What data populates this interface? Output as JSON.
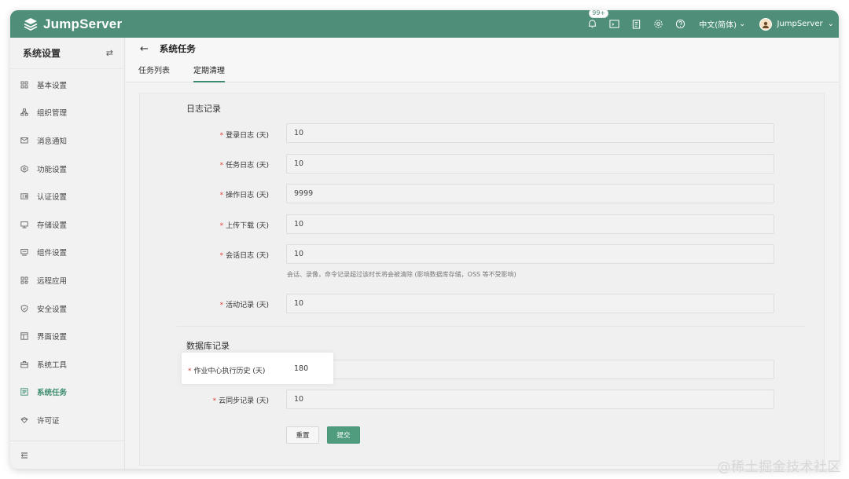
{
  "app": {
    "brand": "JumpServer",
    "accent": "#4f8e79"
  },
  "header": {
    "notification_badge": "99+",
    "icons": [
      "bell-icon",
      "terminal-icon",
      "clipboard-icon",
      "gear-icon",
      "help-icon"
    ],
    "language": "中文(简体)",
    "username": "JumpServer"
  },
  "sidebar": {
    "title": "系统设置",
    "items": [
      {
        "label": "基本设置",
        "icon": "grid-icon"
      },
      {
        "label": "组织管理",
        "icon": "org-icon"
      },
      {
        "label": "消息通知",
        "icon": "message-icon"
      },
      {
        "label": "功能设置",
        "icon": "feature-icon"
      },
      {
        "label": "认证设置",
        "icon": "id-card-icon"
      },
      {
        "label": "存储设置",
        "icon": "storage-icon"
      },
      {
        "label": "组件设置",
        "icon": "component-icon"
      },
      {
        "label": "远程应用",
        "icon": "apps-icon"
      },
      {
        "label": "安全设置",
        "icon": "shield-icon"
      },
      {
        "label": "界面设置",
        "icon": "layout-icon"
      },
      {
        "label": "系统工具",
        "icon": "toolbox-icon"
      },
      {
        "label": "系统任务",
        "icon": "task-icon",
        "active": true
      },
      {
        "label": "许可证",
        "icon": "license-icon"
      }
    ]
  },
  "page": {
    "title": "系统任务",
    "tabs": [
      {
        "label": "任务列表",
        "active": false
      },
      {
        "label": "定期清理",
        "active": true
      }
    ]
  },
  "form": {
    "log_section": "日志记录",
    "fields": [
      {
        "label": "登录日志 (天)",
        "value": "10"
      },
      {
        "label": "任务日志 (天)",
        "value": "10"
      },
      {
        "label": "操作日志 (天)",
        "value": "9999"
      },
      {
        "label": "上传下载 (天)",
        "value": "10"
      },
      {
        "label": "会话日志 (天)",
        "value": "10"
      },
      {
        "label": "活动记录 (天)",
        "value": "10"
      }
    ],
    "session_hint": "会话、录像，命令记录超过该时长将会被清除 (影响数据库存储，OSS 等不受影响)",
    "db_section": "数据库记录",
    "db_fields": [
      {
        "label": "作业中心执行历史 (天)",
        "value": "180"
      },
      {
        "label": "云同步记录 (天)",
        "value": "10"
      }
    ],
    "reset_label": "重置",
    "submit_label": "提交"
  },
  "watermark": "@稀土掘金技术社区"
}
